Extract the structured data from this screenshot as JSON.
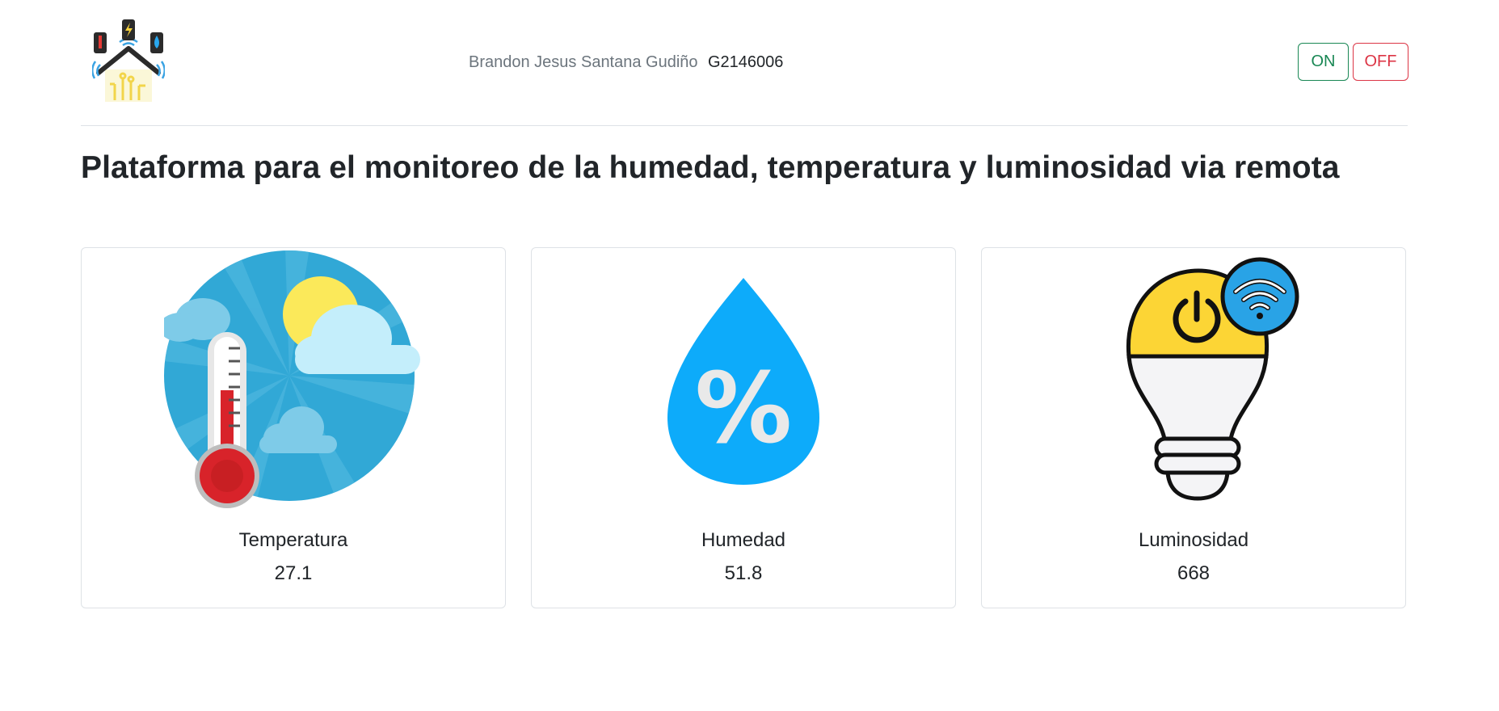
{
  "header": {
    "author": "Brandon Jesus Santana Gudiño",
    "code": "G2146006",
    "on_label": "ON",
    "off_label": "OFF",
    "on_color": "#198754",
    "off_color": "#dc3545",
    "logo_icon": "smart-home-icon"
  },
  "main": {
    "title": "Plataforma para el monitoreo de la humedad, temperatura y luminosidad via remota"
  },
  "cards": [
    {
      "label": "Temperatura",
      "value": "27.1",
      "icon": "thermometer-sky-icon"
    },
    {
      "label": "Humedad",
      "value": "51.8",
      "icon": "humidity-drop-icon"
    },
    {
      "label": "Luminosidad",
      "value": "668",
      "icon": "smart-bulb-icon"
    }
  ]
}
